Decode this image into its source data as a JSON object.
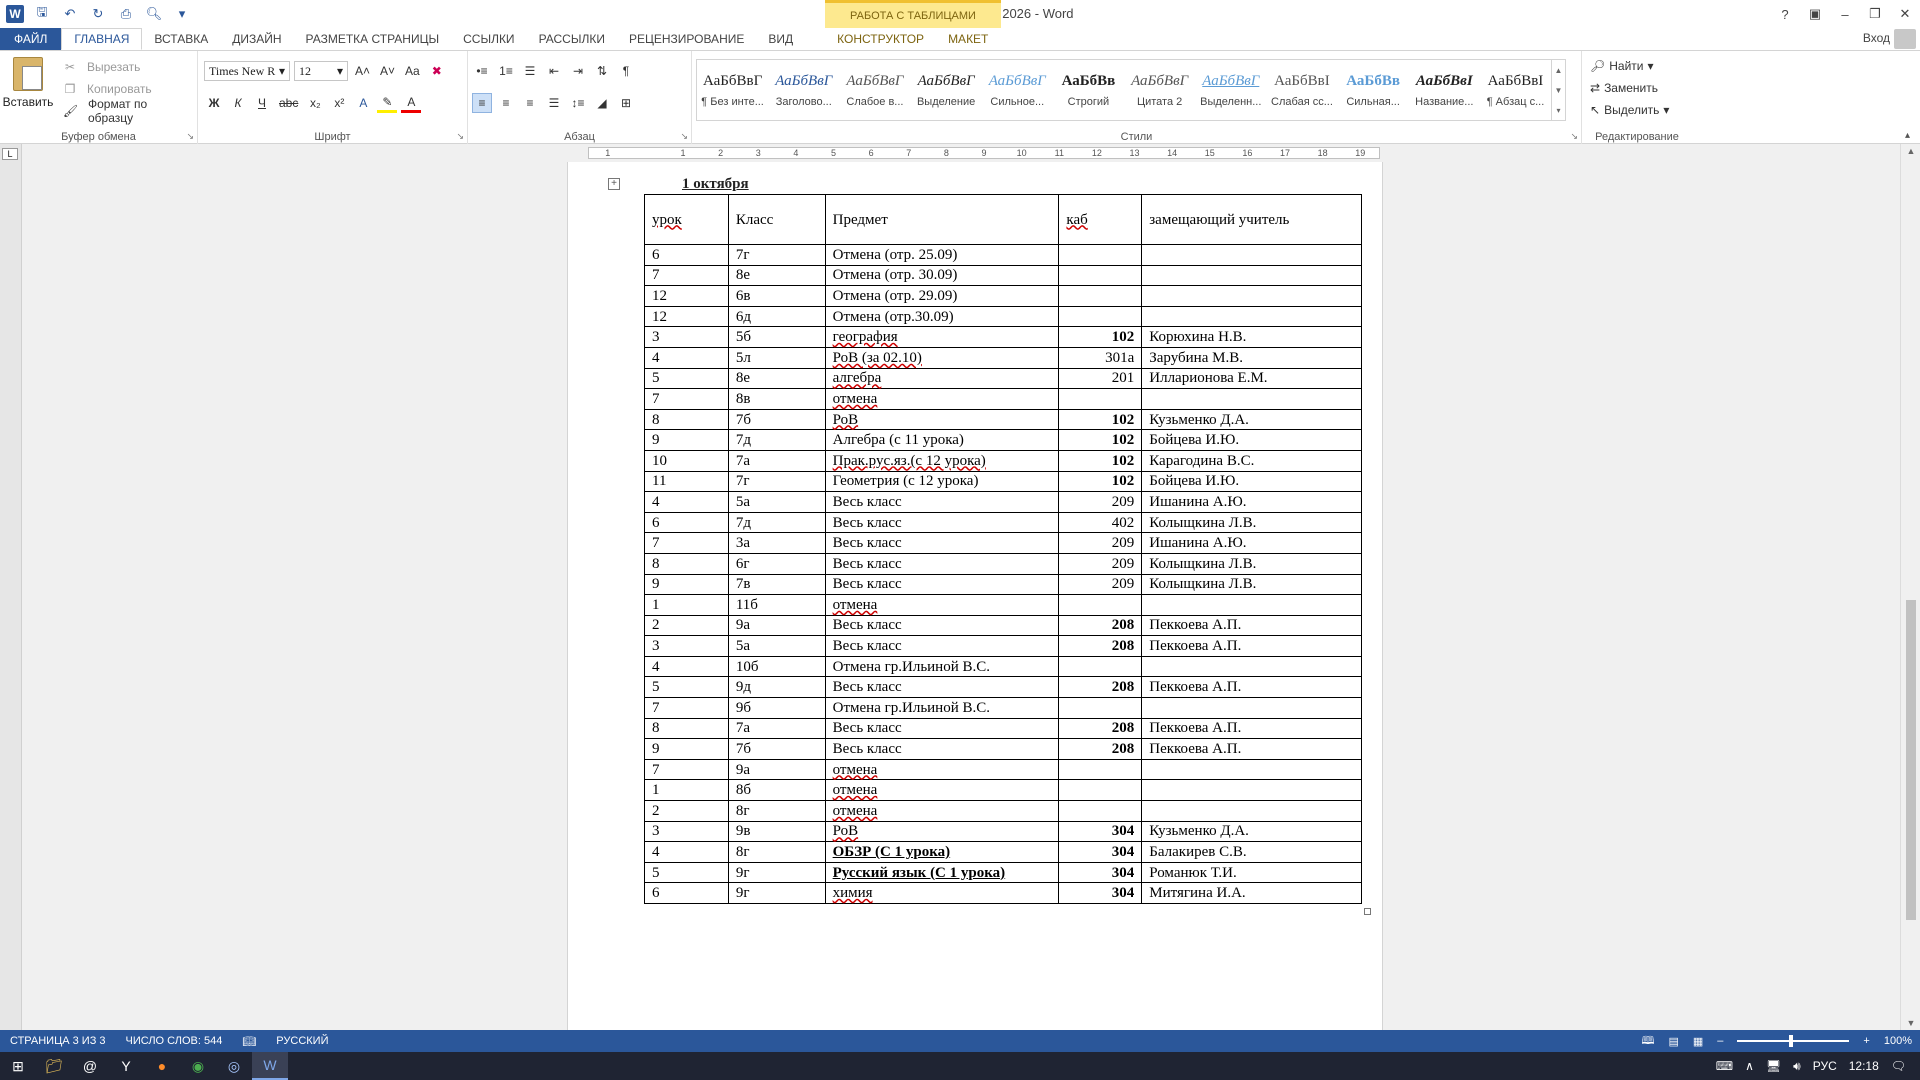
{
  "window": {
    "title": "приказ замены 1 октября 2026 - Word",
    "context_tab_group": "РАБОТА С ТАБЛИЦАМИ",
    "sign_in": "Вход"
  },
  "tabs": [
    {
      "label": "ФАЙЛ"
    },
    {
      "label": "ГЛАВНАЯ"
    },
    {
      "label": "ВСТАВКА"
    },
    {
      "label": "ДИЗАЙН"
    },
    {
      "label": "РАЗМЕТКА СТРАНИЦЫ"
    },
    {
      "label": "ССЫЛКИ"
    },
    {
      "label": "РАССЫЛКИ"
    },
    {
      "label": "РЕЦЕНЗИРОВАНИЕ"
    },
    {
      "label": "ВИД"
    },
    {
      "label": "КОНСТРУКТОР"
    },
    {
      "label": "МАКЕТ"
    }
  ],
  "clipboard": {
    "paste": "Вставить",
    "cut": "Вырезать",
    "copy": "Копировать",
    "format_painter": "Формат по образцу",
    "label": "Буфер обмена"
  },
  "font": {
    "name": "Times New R",
    "size": "12",
    "label": "Шрифт",
    "bold": "Ж",
    "italic": "К",
    "underline": "Ч",
    "strike": "abc",
    "sub": "x₂",
    "sup": "x²",
    "case": "Aa"
  },
  "paragraph": {
    "label": "Абзац",
    "pilcrow": "¶"
  },
  "styles": {
    "label": "Стили",
    "items": [
      {
        "sample": "АаБбВвГ",
        "name": "¶ Без инте..."
      },
      {
        "sample": "АаБбВвГ",
        "name": "Заголово..."
      },
      {
        "sample": "АаБбВвГ",
        "name": "Слабое в..."
      },
      {
        "sample": "АаБбВвГ",
        "name": "Выделение"
      },
      {
        "sample": "АаБбВвГ",
        "name": "Сильное..."
      },
      {
        "sample": "АаБбВв",
        "name": "Строгий"
      },
      {
        "sample": "АаБбВвГ",
        "name": "Цитата 2"
      },
      {
        "sample": "АаБбВвГ",
        "name": "Выделенн..."
      },
      {
        "sample": "АаБбВвІ",
        "name": "Слабая сс..."
      },
      {
        "sample": "АаБбВв",
        "name": "Сильная..."
      },
      {
        "sample": "АаБбВвІ",
        "name": "Название..."
      },
      {
        "sample": "АаБбВвІ",
        "name": "¶ Абзац с..."
      }
    ]
  },
  "editing": {
    "label": "Редактирование",
    "find": "Найти",
    "replace": "Заменить",
    "select": "Выделить"
  },
  "ruler": {
    "marks": [
      "1",
      "",
      "1",
      "2",
      "3",
      "4",
      "5",
      "6",
      "7",
      "8",
      "9",
      "10",
      "11",
      "12",
      "13",
      "14",
      "15",
      "16",
      "17",
      "18",
      "19"
    ]
  },
  "document": {
    "heading": "1 октября",
    "columns": [
      "урок",
      "Класс",
      "Предмет",
      "каб",
      "замещающий учитель"
    ],
    "rows": [
      {
        "lesson": "6",
        "class": "7г",
        "subject": "Отмена (отр. 25.09)",
        "room": "",
        "teacher": ""
      },
      {
        "lesson": "7",
        "class": "8е",
        "subject": "Отмена (отр. 30.09)",
        "room": "",
        "teacher": ""
      },
      {
        "lesson": "12",
        "class": "6в",
        "subject": "Отмена (отр. 29.09)",
        "room": "",
        "teacher": ""
      },
      {
        "lesson": "12",
        "class": "6д",
        "subject": "Отмена (отр.30.09)",
        "room": "",
        "teacher": ""
      },
      {
        "lesson": "3",
        "class": "5б",
        "subject": "география",
        "room": "102",
        "teacher": "Корюхина Н.В."
      },
      {
        "lesson": "4",
        "class": "5л",
        "subject": "РоВ (за 02.10)",
        "room": "301а",
        "teacher": "Зарубина М.В."
      },
      {
        "lesson": "5",
        "class": "8е",
        "subject": "алгебра",
        "room": "201",
        "teacher": "Илларионова Е.М."
      },
      {
        "lesson": "7",
        "class": "8в",
        "subject": "отмена",
        "room": "",
        "teacher": ""
      },
      {
        "lesson": "8",
        "class": "7б",
        "subject": "РоВ",
        "room": "102",
        "teacher": "Кузьменко Д.А."
      },
      {
        "lesson": "9",
        "class": "7д",
        "subject": "Алгебра (с 11 урока)",
        "room": "102",
        "teacher": "Бойцева И.Ю."
      },
      {
        "lesson": "10",
        "class": "7а",
        "subject": "Прак.рус.яз.(с 12 урока)",
        "room": "102",
        "teacher": "Карагодина В.С."
      },
      {
        "lesson": "11",
        "class": "7г",
        "subject": "Геометрия (с 12 урока)",
        "room": "102",
        "teacher": "Бойцева И.Ю."
      },
      {
        "lesson": "4",
        "class": "5а",
        "subject": "Весь класс",
        "room": "209",
        "teacher": "Ишанина А.Ю."
      },
      {
        "lesson": "6",
        "class": "7д",
        "subject": "Весь класс",
        "room": "402",
        "teacher": "Колыщкина Л.В."
      },
      {
        "lesson": "7",
        "class": "3а",
        "subject": "Весь класс",
        "room": "209",
        "teacher": "Ишанина А.Ю."
      },
      {
        "lesson": "8",
        "class": "6г",
        "subject": "Весь класс",
        "room": "209",
        "teacher": "Колыщкина Л.В."
      },
      {
        "lesson": "9",
        "class": "7в",
        "subject": "Весь класс",
        "room": "209",
        "teacher": "Колыщкина Л.В."
      },
      {
        "lesson": "1",
        "class": "11б",
        "subject": "отмена",
        "room": "",
        "teacher": ""
      },
      {
        "lesson": "2",
        "class": "9а",
        "subject": "Весь класс",
        "room": "208",
        "teacher": "Пеккоева А.П."
      },
      {
        "lesson": "3",
        "class": "5а",
        "subject": "Весь класс",
        "room": "208",
        "teacher": "Пеккоева А.П."
      },
      {
        "lesson": "4",
        "class": "10б",
        "subject": "Отмена гр.Ильиной В.С.",
        "room": "",
        "teacher": ""
      },
      {
        "lesson": "5",
        "class": "9д",
        "subject": "Весь класс",
        "room": "208",
        "teacher": "Пеккоева А.П."
      },
      {
        "lesson": "7",
        "class": "9б",
        "subject": "Отмена гр.Ильиной В.С.",
        "room": "",
        "teacher": ""
      },
      {
        "lesson": "8",
        "class": "7а",
        "subject": "Весь класс",
        "room": "208",
        "teacher": "Пеккоева А.П."
      },
      {
        "lesson": "9",
        "class": "7б",
        "subject": "Весь класс",
        "room": "208",
        "teacher": "Пеккоева А.П."
      },
      {
        "lesson": "7",
        "class": "9а",
        "subject": "отмена",
        "room": "",
        "teacher": ""
      },
      {
        "lesson": "1",
        "class": "8б",
        "subject": "отмена",
        "room": "",
        "teacher": ""
      },
      {
        "lesson": "2",
        "class": "8г",
        "subject": "отмена",
        "room": "",
        "teacher": ""
      },
      {
        "lesson": "3",
        "class": "9в",
        "subject": "РоВ",
        "room": "304",
        "teacher": "Кузьменко Д.А."
      },
      {
        "lesson": "4",
        "class": "8г",
        "subject": "ОБЗР (С 1 урока)",
        "room": "304",
        "teacher": "Балакирев С.В."
      },
      {
        "lesson": "5",
        "class": "9г",
        "subject": "Русский язык (С 1 урока)",
        "room": "304",
        "teacher": "Романюк Т.И."
      },
      {
        "lesson": "6",
        "class": "9г",
        "subject": "химия",
        "room": "304",
        "teacher": "Митягина И.А."
      }
    ]
  },
  "statusbar": {
    "page": "СТРАНИЦА 3 ИЗ 3",
    "words": "ЧИСЛО СЛОВ: 544",
    "language": "РУССКИЙ",
    "zoom": "100%"
  },
  "taskbar": {
    "lang": "РУС",
    "time": "12:18"
  },
  "colors": {
    "accent": "#2b579a",
    "context": "#fde98f"
  }
}
